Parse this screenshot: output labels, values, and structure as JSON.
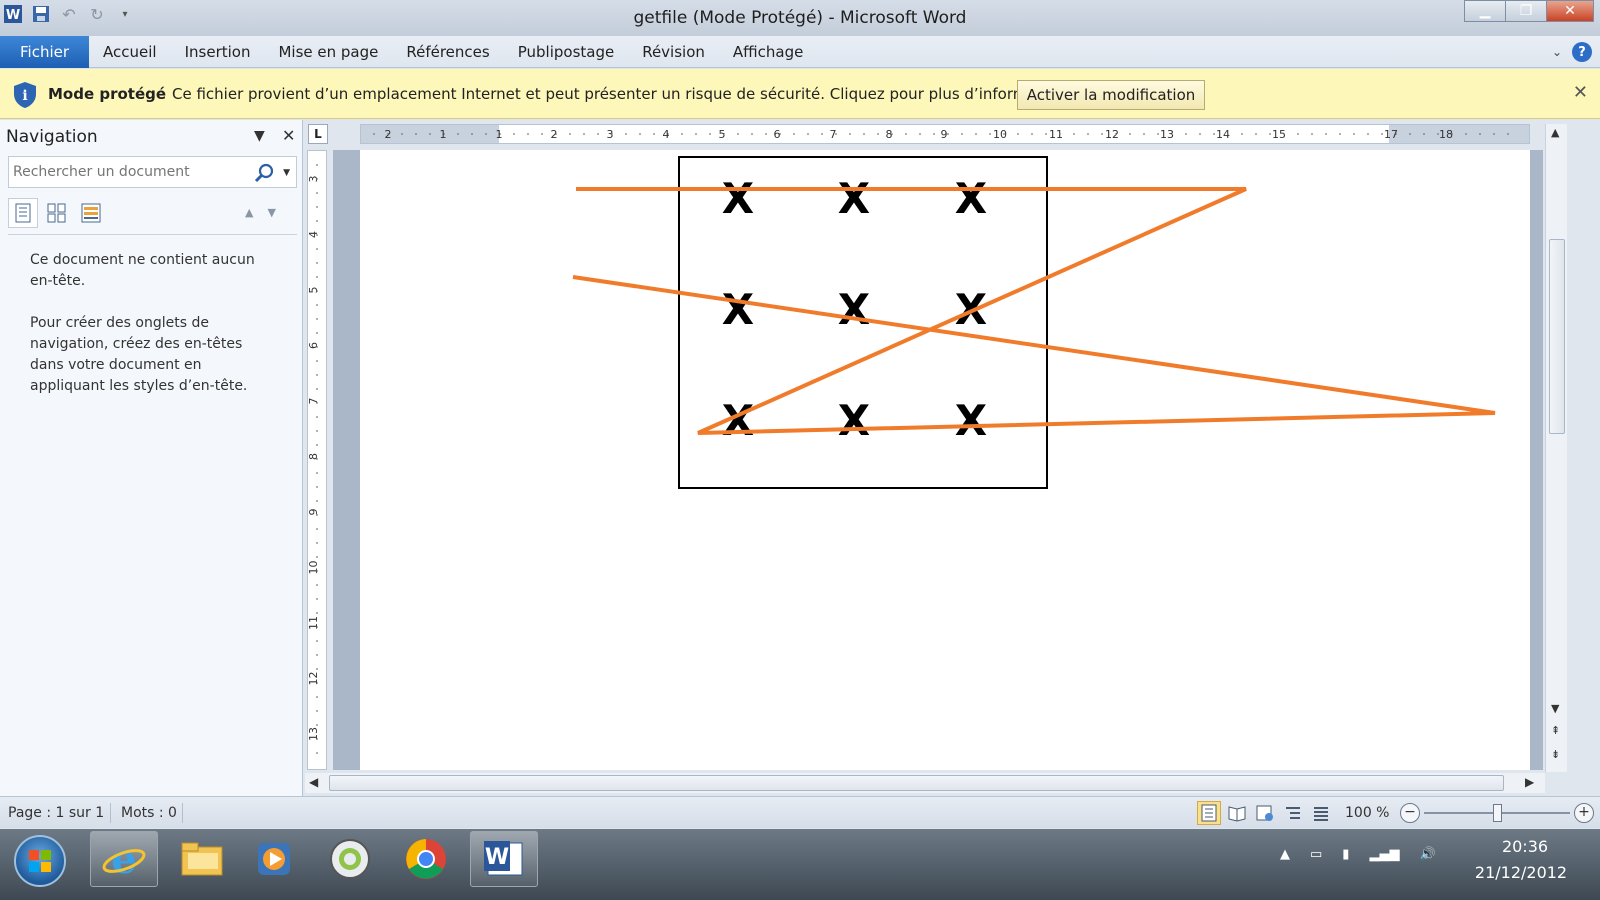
{
  "window": {
    "title": "getfile (Mode Protégé)  -  Microsoft Word",
    "controls": [
      "minimize-button",
      "maximize-button",
      "close-button"
    ]
  },
  "ribbon": {
    "tabs": [
      "Fichier",
      "Accueil",
      "Insertion",
      "Mise en page",
      "Références",
      "Publipostage",
      "Révision",
      "Affichage"
    ]
  },
  "protected_bar": {
    "title": "Mode protégé",
    "message": "Ce fichier provient d’un emplacement Internet et peut présenter un risque de sécurité. Cliquez pour plus d’informations.",
    "button": "Activer la modification"
  },
  "navigation": {
    "title": "Navigation",
    "search_placeholder": "Rechercher un document",
    "empty_message": "Ce document ne contient aucun en-tête.",
    "help_message": "Pour créer des onglets de navigation, créez des en-têtes dans votre document en appliquant les styles d’en-tête."
  },
  "ruler": {
    "corner": "L",
    "h_labels": [
      "2",
      "1",
      "1",
      "2",
      "3",
      "4",
      "5",
      "6",
      "7",
      "8",
      "9",
      "10",
      "11",
      "12",
      "13",
      "14",
      "15",
      "17",
      "18"
    ],
    "v_labels": [
      "3",
      "4",
      "5",
      "6",
      "7",
      "8",
      "9",
      "10",
      "11",
      "12",
      "13"
    ]
  },
  "document": {
    "grid_marks": [
      "X",
      "X",
      "X",
      "X",
      "X",
      "X",
      "X",
      "X",
      "X"
    ],
    "line_color": "#f07c2b"
  },
  "status": {
    "page": "Page : 1 sur 1",
    "words": "Mots : 0",
    "zoom": "100 %"
  },
  "taskbar": {
    "apps": [
      "internet-explorer",
      "file-explorer",
      "media-player",
      "unknown-app",
      "chrome",
      "word"
    ],
    "time": "20:36",
    "date": "21/12/2012"
  },
  "colors": {
    "accent": "#2b579a",
    "protected_bg": "#fdf7b9",
    "drawing_line": "#f07c2b"
  }
}
